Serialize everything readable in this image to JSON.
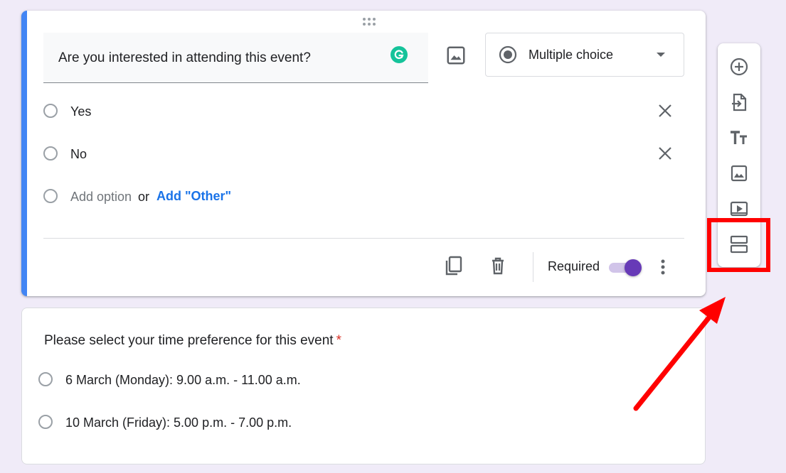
{
  "question1": {
    "title": "Are you interested in attending this event?",
    "type_label": "Multiple choice",
    "options": [
      {
        "label": "Yes"
      },
      {
        "label": "No"
      }
    ],
    "add_option": "Add option",
    "add_or": "or",
    "add_other": "Add \"Other\"",
    "required_label": "Required",
    "required": true
  },
  "question2": {
    "title": "Please select your time preference for this event",
    "required_marker": "*",
    "options": [
      {
        "label": "6 March (Monday): 9.00 a.m. - 11.00 a.m."
      },
      {
        "label": "10 March (Friday): 5.00 p.m. - 7.00 p.m."
      }
    ]
  },
  "toolbar": {
    "items": [
      "add-question-icon",
      "import-questions-icon",
      "add-title-icon",
      "add-image-icon",
      "add-video-icon",
      "add-section-icon"
    ]
  },
  "colors": {
    "accent": "#673ab7",
    "active_border": "#4285f4",
    "link": "#1a73e8",
    "required_star": "#d93025",
    "annotation": "#ff0000",
    "background": "#f0ebf8"
  }
}
